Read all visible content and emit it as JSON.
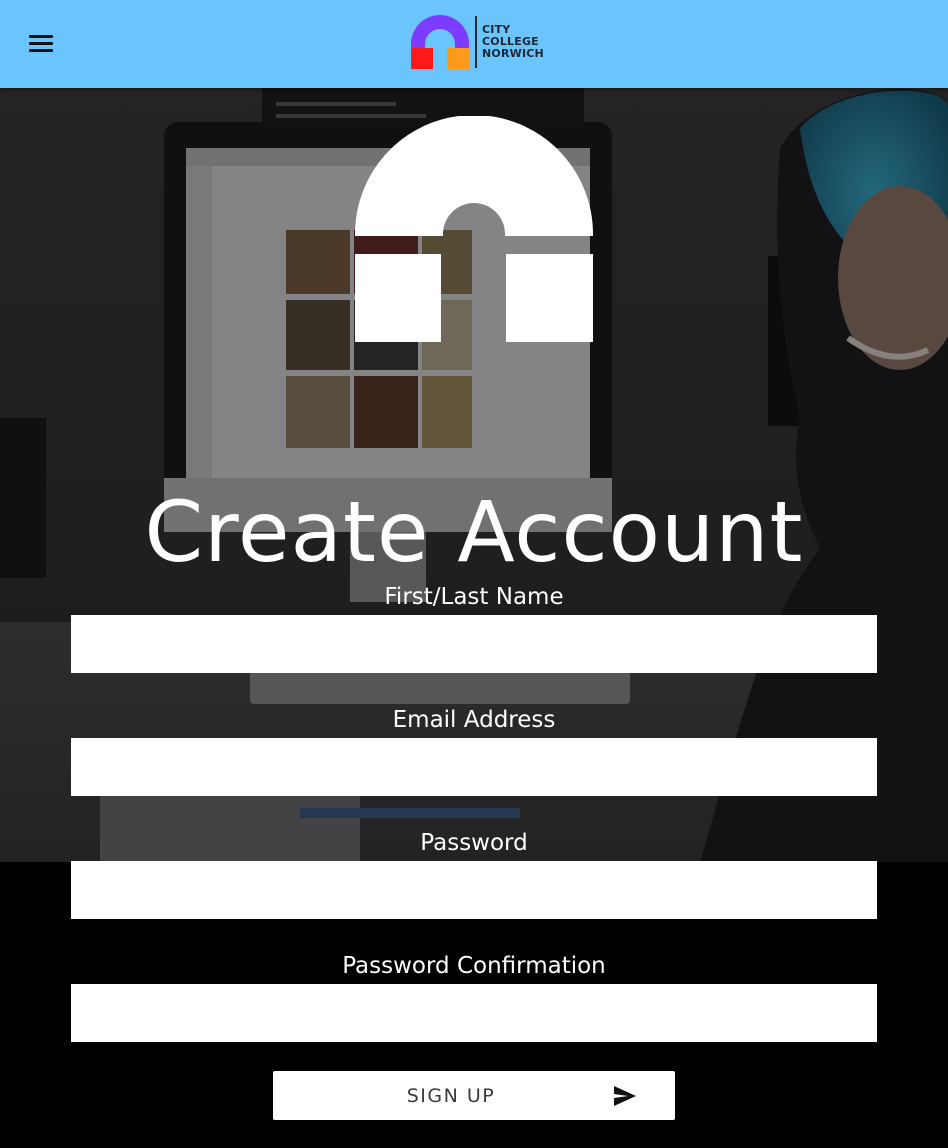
{
  "header": {
    "menu_icon": "hamburger-menu-icon",
    "logo_icon": "city-college-norwich-arch-icon",
    "brand_lines": [
      "CITY",
      "COLLEGE",
      "NORWICH"
    ],
    "colors": {
      "bar": "#6ac5fe",
      "arch_purple": "#7d3bff",
      "block_red": "#ff1a1a",
      "block_orange": "#ff9a1a"
    }
  },
  "hero": {
    "logo_icon": "arch-logo-icon"
  },
  "page": {
    "title": "Create Account"
  },
  "form": {
    "fields": [
      {
        "label": "First/Last Name",
        "value": "",
        "placeholder": ""
      },
      {
        "label": "Email Address",
        "value": "",
        "placeholder": ""
      },
      {
        "label": "Password",
        "value": "",
        "placeholder": ""
      },
      {
        "label": "Password Confirmation",
        "value": "",
        "placeholder": ""
      }
    ],
    "submit": {
      "label": "SIGN UP",
      "icon": "send-icon"
    }
  }
}
